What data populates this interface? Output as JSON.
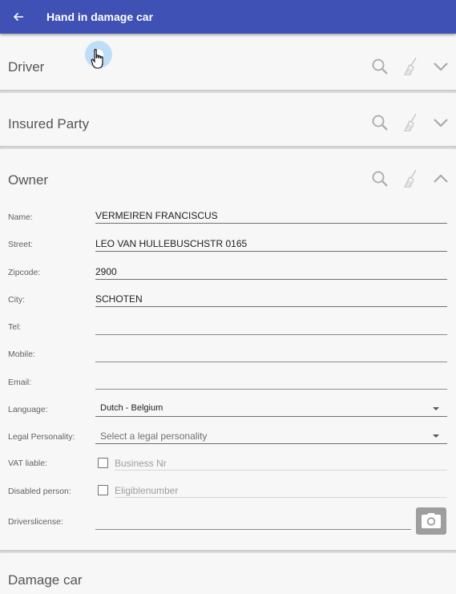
{
  "appbar": {
    "title": "Hand in damage car",
    "back_icon": "arrow-left-icon"
  },
  "sections": {
    "driver": {
      "title": "Driver",
      "expanded": false
    },
    "insured": {
      "title": "Insured Party",
      "expanded": false
    },
    "owner": {
      "title": "Owner",
      "expanded": true
    },
    "damage": {
      "title": "Damage car"
    }
  },
  "owner_form": {
    "name": {
      "label": "Name:",
      "value": "VERMEIREN FRANCISCUS"
    },
    "street": {
      "label": "Street:",
      "value": "LEO VAN HULLEBUSCHSTR 0165"
    },
    "zipcode": {
      "label": "Zipcode:",
      "value": "2900"
    },
    "city": {
      "label": "City:",
      "value": "SCHOTEN"
    },
    "tel": {
      "label": "Tel:",
      "value": ""
    },
    "mobile": {
      "label": "Mobile:",
      "value": ""
    },
    "email": {
      "label": "Email:",
      "value": ""
    },
    "language": {
      "label": "Language:",
      "value": "Dutch - Belgium"
    },
    "legal_personality": {
      "label": "Legal Personality:",
      "placeholder": "Select a legal personality"
    },
    "vat_liable": {
      "label": "VAT liable:",
      "checked": false,
      "placeholder": "Business Nr"
    },
    "disabled_person": {
      "label": "Disabled person:",
      "checked": false,
      "placeholder": "Eligiblenumber"
    },
    "driverslicense": {
      "label": "Driverslicense:",
      "value": ""
    }
  },
  "colors": {
    "appbar": "#3f51b5",
    "background": "#f7f7f7",
    "camera_button": "#9e9e9e"
  }
}
